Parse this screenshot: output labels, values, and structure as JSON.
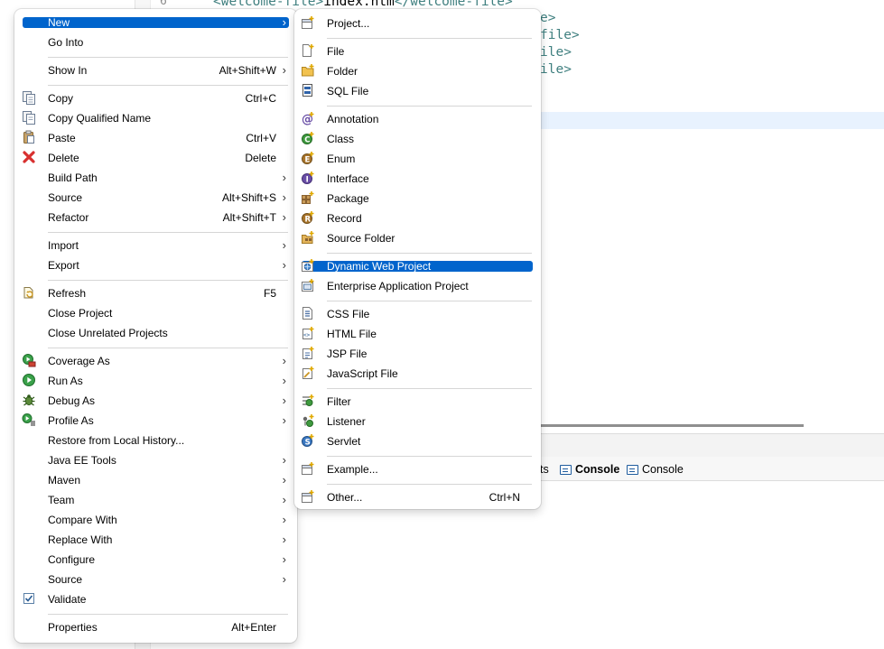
{
  "editor": {
    "line_number": "6",
    "lines": [
      {
        "pre": "<welcome-file>",
        "text": "index.htm",
        "post": "</welcome-file>"
      },
      {
        "pre": "",
        "text": "",
        "post": "e>"
      },
      {
        "pre": "",
        "text": "",
        "post": "file>"
      },
      {
        "pre": "",
        "text": "",
        "post": "ile>"
      },
      {
        "pre": "",
        "text": "",
        "post": "ile>"
      }
    ]
  },
  "view_tabs": [
    {
      "label": "ts"
    },
    {
      "label": "Console"
    },
    {
      "label": "Console"
    }
  ],
  "context_menu": {
    "items": [
      {
        "label": "New",
        "shortcut": "",
        "arrow": "›"
      },
      {
        "label": "Go Into",
        "shortcut": "",
        "arrow": ""
      },
      {
        "label": "Show In",
        "shortcut": "Alt+Shift+W",
        "arrow": "›"
      },
      {
        "label": "Copy",
        "shortcut": "Ctrl+C",
        "arrow": ""
      },
      {
        "label": "Copy Qualified Name",
        "shortcut": "",
        "arrow": ""
      },
      {
        "label": "Paste",
        "shortcut": "Ctrl+V",
        "arrow": ""
      },
      {
        "label": "Delete",
        "shortcut": "Delete",
        "arrow": ""
      },
      {
        "label": "Build Path",
        "shortcut": "",
        "arrow": "›"
      },
      {
        "label": "Source",
        "shortcut": "Alt+Shift+S",
        "arrow": "›"
      },
      {
        "label": "Refactor",
        "shortcut": "Alt+Shift+T",
        "arrow": "›"
      },
      {
        "label": "Import",
        "shortcut": "",
        "arrow": "›"
      },
      {
        "label": "Export",
        "shortcut": "",
        "arrow": "›"
      },
      {
        "label": "Refresh",
        "shortcut": "F5",
        "arrow": ""
      },
      {
        "label": "Close Project",
        "shortcut": "",
        "arrow": ""
      },
      {
        "label": "Close Unrelated Projects",
        "shortcut": "",
        "arrow": ""
      },
      {
        "label": "Coverage As",
        "shortcut": "",
        "arrow": "›"
      },
      {
        "label": "Run As",
        "shortcut": "",
        "arrow": "›"
      },
      {
        "label": "Debug As",
        "shortcut": "",
        "arrow": "›"
      },
      {
        "label": "Profile As",
        "shortcut": "",
        "arrow": "›"
      },
      {
        "label": "Restore from Local History...",
        "shortcut": "",
        "arrow": ""
      },
      {
        "label": "Java EE Tools",
        "shortcut": "",
        "arrow": "›"
      },
      {
        "label": "Maven",
        "shortcut": "",
        "arrow": "›"
      },
      {
        "label": "Team",
        "shortcut": "",
        "arrow": "›"
      },
      {
        "label": "Compare With",
        "shortcut": "",
        "arrow": "›"
      },
      {
        "label": "Replace With",
        "shortcut": "",
        "arrow": "›"
      },
      {
        "label": "Configure",
        "shortcut": "",
        "arrow": "›"
      },
      {
        "label": "Source",
        "shortcut": "",
        "arrow": "›"
      },
      {
        "label": "Validate",
        "shortcut": "",
        "arrow": ""
      },
      {
        "label": "Properties",
        "shortcut": "Alt+Enter",
        "arrow": ""
      }
    ]
  },
  "new_submenu": {
    "items": [
      {
        "label": "Project...",
        "shortcut": ""
      },
      {
        "label": "File",
        "shortcut": ""
      },
      {
        "label": "Folder",
        "shortcut": ""
      },
      {
        "label": "SQL File",
        "shortcut": ""
      },
      {
        "label": "Annotation",
        "shortcut": ""
      },
      {
        "label": "Class",
        "shortcut": ""
      },
      {
        "label": "Enum",
        "shortcut": ""
      },
      {
        "label": "Interface",
        "shortcut": ""
      },
      {
        "label": "Package",
        "shortcut": ""
      },
      {
        "label": "Record",
        "shortcut": ""
      },
      {
        "label": "Source Folder",
        "shortcut": ""
      },
      {
        "label": "Dynamic Web Project",
        "shortcut": ""
      },
      {
        "label": "Enterprise Application Project",
        "shortcut": ""
      },
      {
        "label": "CSS File",
        "shortcut": ""
      },
      {
        "label": "HTML File",
        "shortcut": ""
      },
      {
        "label": "JSP File",
        "shortcut": ""
      },
      {
        "label": "JavaScript File",
        "shortcut": ""
      },
      {
        "label": "Filter",
        "shortcut": ""
      },
      {
        "label": "Listener",
        "shortcut": ""
      },
      {
        "label": "Servlet",
        "shortcut": ""
      },
      {
        "label": "Example...",
        "shortcut": ""
      },
      {
        "label": "Other...",
        "shortcut": "Ctrl+N"
      }
    ]
  },
  "colors": {
    "selection": "#0064cc",
    "xml_tag": "#3f7f7f",
    "current_line": "#e8f2fe"
  }
}
